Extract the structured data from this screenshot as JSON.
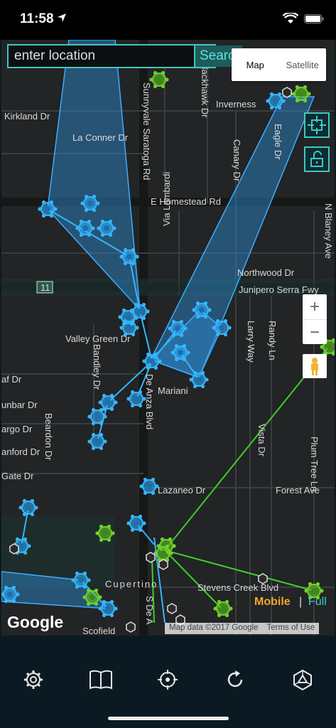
{
  "status_bar": {
    "time": "11:58"
  },
  "search": {
    "placeholder": "enter location",
    "button_label": "Search"
  },
  "map_type": {
    "map_label": "Map",
    "satellite_label": "Satellite",
    "selected": "Map"
  },
  "map_labels": {
    "kirkland": "Kirkland Dr",
    "la_conner": "La Conner Dr",
    "sunnyvale": "Sunnyvale Saratoga Rd",
    "blackhawk": "Blackhawk Dr",
    "inverness": "Inverness",
    "eagle": "Eagle Dr",
    "canary": "Canary Dr",
    "homestead": "E Homestead Rd",
    "via_lombardi": "Via Lombardi",
    "northwood": "Northwood Dr",
    "junipero": "Junipero Serra Fwy",
    "hwy_shield": "11",
    "valley_green": "Valley Green Dr",
    "bandley": "Bandley Dr",
    "larry": "Larry Way",
    "randy": "Randy Ln",
    "mariani": "Mariani",
    "anza": "De Anza Blvd",
    "blaney": "N Blaney Ave",
    "af": "af Dr",
    "unbar": "unbar Dr",
    "argo": "argo Dr",
    "anford": "anford Dr",
    "beardon": "Beardon Dr",
    "gate": "Gate Dr",
    "vista": "Vista Dr",
    "plum": "Plum Tree Ln",
    "forest": "Forest Ave",
    "lazaneo": "Lazaneo Dr",
    "cupertino": "Cupertino",
    "stevens": "Stevens Creek Blvd",
    "scofield": "Scofield",
    "s_de_a": "S De A"
  },
  "map_footer": {
    "google": "Google",
    "map_data": "Map data ©2017 Google",
    "terms": "Terms of Use",
    "mobile": "Mobile",
    "separator": "|",
    "full": "Full"
  },
  "colors": {
    "accent": "#3fc8c0",
    "portal_blue": "#35b6ff",
    "portal_green": "#6fd12a",
    "background": "#222425"
  },
  "toolbar_icons": [
    "gear-icon",
    "book-icon",
    "target-icon",
    "refresh-icon",
    "ingress-logo-icon"
  ]
}
